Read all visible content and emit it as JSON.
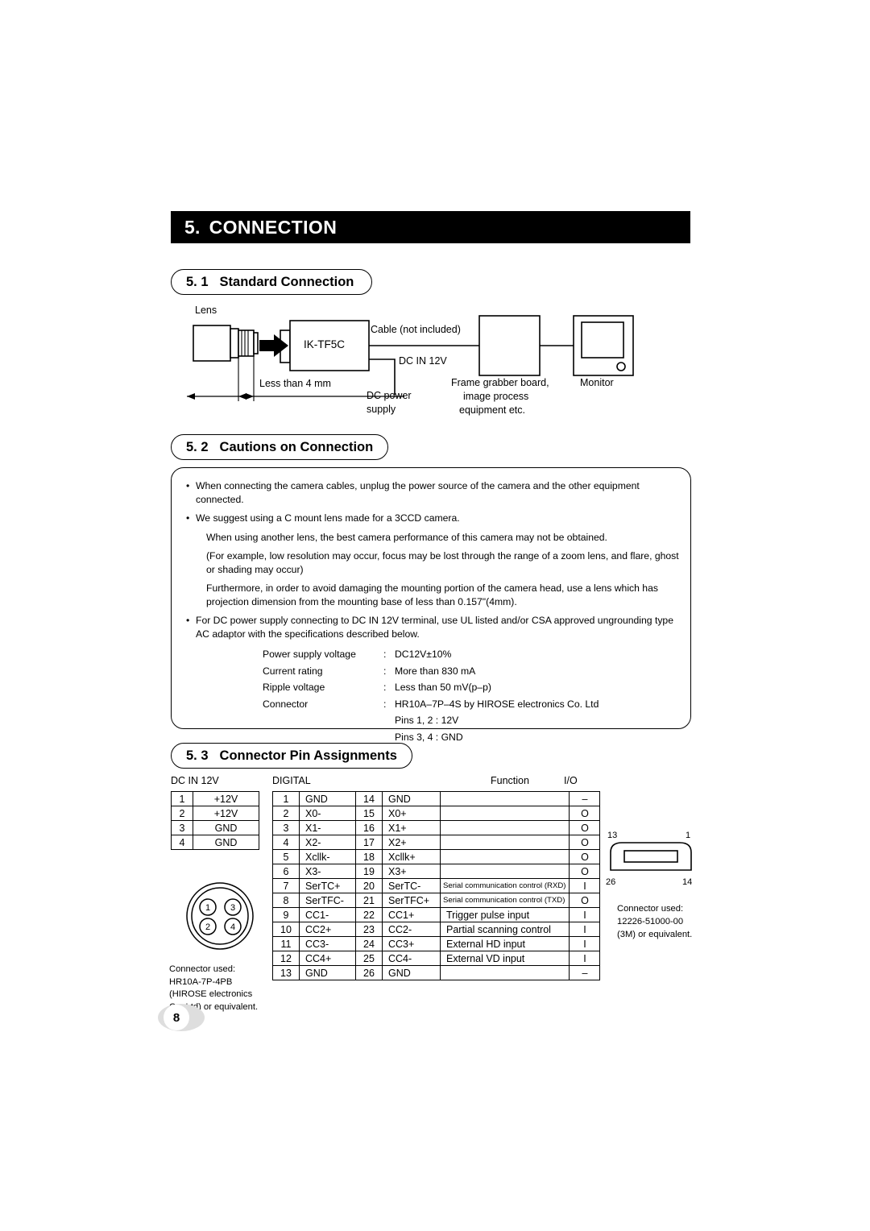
{
  "chapter": {
    "number": "5.",
    "title": "CONNECTION"
  },
  "sections": {
    "s51": {
      "number": "5. 1",
      "title": "Standard Connection"
    },
    "s52": {
      "number": "5. 2",
      "title": "Cautions on Connection"
    },
    "s53": {
      "number": "5. 3",
      "title": "Connector Pin Assignments"
    }
  },
  "diagram": {
    "lens_label": "Lens",
    "camera_label": "IK-TF5C",
    "cable_label": "Cable (not included)",
    "dc_in_label": "DC IN 12V",
    "dc_power_line1": "DC power",
    "dc_power_line2": "supply",
    "dimension_label": "Less than 4 mm",
    "frame_grabber_line1": "Frame grabber board,",
    "frame_grabber_line2": "image process",
    "frame_grabber_line3": "equipment etc.",
    "monitor_label": "Monitor"
  },
  "cautions": {
    "bullet1": "When connecting the camera cables, unplug the power source of the camera and the other equipment connected.",
    "bullet2": "We suggest using a C mount lens made for a 3CCD camera.",
    "para1": "When using another lens, the best camera performance of this camera may not be obtained.",
    "para2": "(For example, low resolution may occur, focus may be lost through the range of a zoom lens, and flare, ghost or shading may occur)",
    "para3": "Furthermore, in order to avoid damaging the mounting portion of the camera head, use a lens which has projection dimension from the mounting base of less than 0.157\"(4mm).",
    "bullet3": "For DC power supply connecting to DC IN 12V terminal, use UL listed and/or CSA approved ungrounding type AC adaptor with the specifications described below.",
    "spec_rows": [
      {
        "name": "Power supply voltage",
        "colon": ":",
        "value": "DC12V±10%"
      },
      {
        "name": "Current rating",
        "colon": ":",
        "value": "More than 830 mA"
      },
      {
        "name": "Ripple voltage",
        "colon": ":",
        "value": "Less than 50 mV(p–p)"
      },
      {
        "name": "Connector",
        "colon": ":",
        "value": "HR10A–7P–4S by HIROSE electronics Co. Ltd"
      }
    ],
    "spec_extra": [
      "Pins 1, 2 : 12V",
      "Pins 3, 4 : GND"
    ]
  },
  "pin_assignments": {
    "dcin": {
      "caption": "DC IN 12V",
      "rows": [
        {
          "pin": "1",
          "name": "+12V"
        },
        {
          "pin": "2",
          "name": "+12V"
        },
        {
          "pin": "3",
          "name": "GND"
        },
        {
          "pin": "4",
          "name": "GND"
        }
      ],
      "connector_note": [
        "Connector used:",
        "HR10A-7P-4PB",
        "(HIROSE electronics",
        "Co. Ltd) or equivalent."
      ],
      "pin_circles": [
        "1",
        "3",
        "2",
        "4"
      ]
    },
    "digital": {
      "caption": "DIGITAL",
      "function_header": "Function",
      "io_header": "I/O",
      "rows": [
        {
          "pin_a": "1",
          "name_a": "GND",
          "pin_b": "14",
          "name_b": "GND",
          "function": "",
          "io": "–",
          "small": false
        },
        {
          "pin_a": "2",
          "name_a": "X0-",
          "pin_b": "15",
          "name_b": "X0+",
          "function": "",
          "io": "O",
          "small": false
        },
        {
          "pin_a": "3",
          "name_a": "X1-",
          "pin_b": "16",
          "name_b": "X1+",
          "function": "",
          "io": "O",
          "small": false
        },
        {
          "pin_a": "4",
          "name_a": "X2-",
          "pin_b": "17",
          "name_b": "X2+",
          "function": "",
          "io": "O",
          "small": false
        },
        {
          "pin_a": "5",
          "name_a": "Xcllk-",
          "pin_b": "18",
          "name_b": "Xcllk+",
          "function": "",
          "io": "O",
          "small": false
        },
        {
          "pin_a": "6",
          "name_a": "X3-",
          "pin_b": "19",
          "name_b": "X3+",
          "function": "",
          "io": "O",
          "small": false
        },
        {
          "pin_a": "7",
          "name_a": "SerTC+",
          "pin_b": "20",
          "name_b": "SerTC-",
          "function": "Serial communication control (RXD)",
          "io": "I",
          "small": true
        },
        {
          "pin_a": "8",
          "name_a": "SerTFC-",
          "pin_b": "21",
          "name_b": "SerTFC+",
          "function": "Serial communication control (TXD)",
          "io": "O",
          "small": true
        },
        {
          "pin_a": "9",
          "name_a": "CC1-",
          "pin_b": "22",
          "name_b": "CC1+",
          "function": "Trigger pulse input",
          "io": "I",
          "small": false
        },
        {
          "pin_a": "10",
          "name_a": "CC2+",
          "pin_b": "23",
          "name_b": "CC2-",
          "function": "Partial scanning control",
          "io": "I",
          "small": false
        },
        {
          "pin_a": "11",
          "name_a": "CC3-",
          "pin_b": "24",
          "name_b": "CC3+",
          "function": "External HD input",
          "io": "I",
          "small": false
        },
        {
          "pin_a": "12",
          "name_a": "CC4+",
          "pin_b": "25",
          "name_b": "CC4-",
          "function": "External VD input",
          "io": "I",
          "small": false
        },
        {
          "pin_a": "13",
          "name_a": "GND",
          "pin_b": "26",
          "name_b": "GND",
          "function": "",
          "io": "–",
          "small": false
        }
      ],
      "connector_note": [
        "Connector used:",
        "12226-51000-00",
        "(3M) or equivalent."
      ],
      "corner_labels": {
        "top_left": "13",
        "top_right": "1",
        "bottom_left": "26",
        "bottom_right": "14"
      }
    }
  },
  "page_number": "8",
  "colors": {
    "bar_background": "#000000",
    "bar_text": "#ffffff",
    "page_badge": "#dedede",
    "ink": "#000000"
  }
}
